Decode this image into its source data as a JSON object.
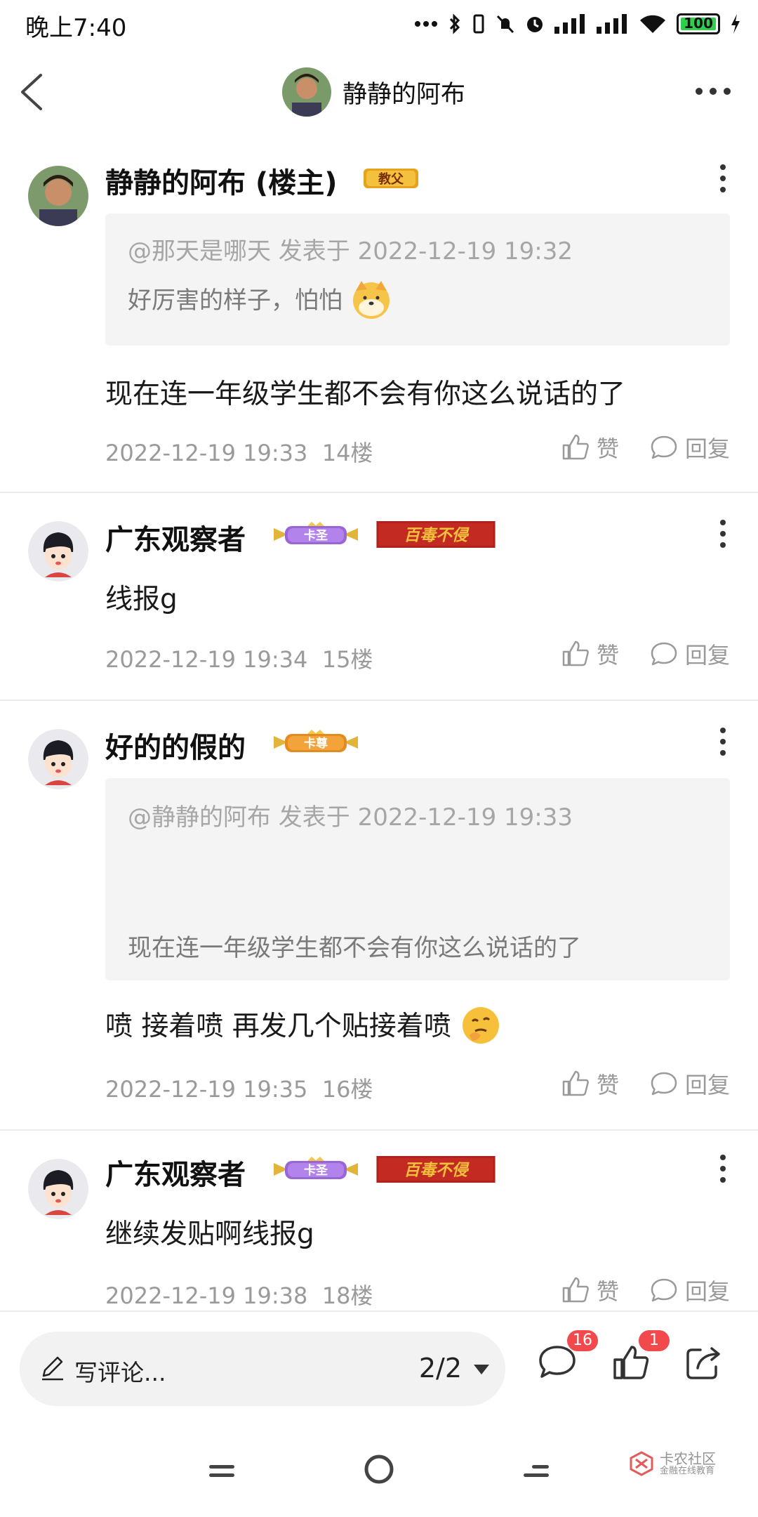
{
  "status": {
    "time": "晚上7:40",
    "battery": "100",
    "icons": [
      "more-dots-icon",
      "bluetooth-icon",
      "vibrate-icon",
      "mute-icon",
      "alarm-icon",
      "signal-icon",
      "signal-icon",
      "wifi-icon",
      "battery-icon",
      "charging-icon"
    ]
  },
  "nav": {
    "title": "静静的阿布",
    "back_icon": "chevron-left-icon",
    "more_icon": "more-horizontal-icon"
  },
  "posts": [
    {
      "username": "静静的阿布 (楼主)",
      "badges": [
        "教父"
      ],
      "quote": {
        "meta": "@那天是哪天 发表于 2022-12-19 19:32",
        "text": "好厉害的样子，怕怕"
      },
      "body": "现在连一年级学生都不会有你这么说话的了",
      "time": "2022-12-19 19:33",
      "floor": "14楼",
      "like": "赞",
      "reply": "回复"
    },
    {
      "username": "广东观察者",
      "badges": [
        "卡圣",
        "百毒不侵"
      ],
      "body": "线报g",
      "time": "2022-12-19 19:34",
      "floor": "15楼",
      "like": "赞",
      "reply": "回复"
    },
    {
      "username": "好的的假的",
      "badges": [
        "卡尊"
      ],
      "quote": {
        "meta": "@静静的阿布 发表于 2022-12-19 19:33",
        "text": "现在连一年级学生都不会有你这么说话的了"
      },
      "body": "喷  接着喷  再发几个贴接着喷",
      "time": "2022-12-19 19:35",
      "floor": "16楼",
      "like": "赞",
      "reply": "回复"
    },
    {
      "username": "广东观察者",
      "badges": [
        "卡圣",
        "百毒不侵"
      ],
      "body": "继续发贴啊线报g",
      "time": "2022-12-19 19:38",
      "floor": "18楼",
      "like": "赞",
      "reply": "回复"
    }
  ],
  "bottom": {
    "comment_placeholder": "写评论...",
    "page_indicator": "2/2",
    "comment_count": "16",
    "like_count": "1"
  },
  "watermark": {
    "name": "卡农社区",
    "sub": "金融在线教育"
  },
  "colors": {
    "accent_red": "#f2494d",
    "badge_gold": "#e7a21b",
    "badge_purple": "#8e5bd1",
    "badge_darkred": "#b0201c"
  }
}
